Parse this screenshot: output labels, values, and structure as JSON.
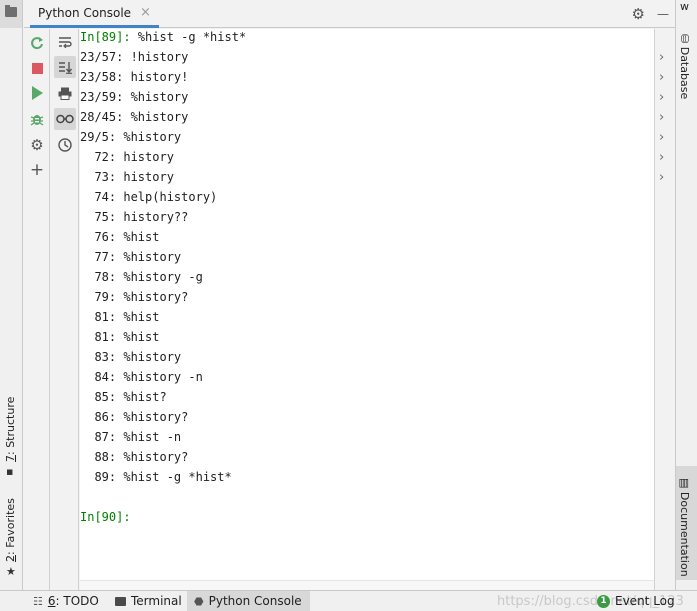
{
  "tab": {
    "title": "Python Console",
    "close": "×"
  },
  "title_tools": {
    "settings_icon": "⚙",
    "minimize_icon": "—"
  },
  "toolbar": {
    "rerun": "rerun-icon",
    "stop": "stop-icon",
    "run": "run-icon",
    "debug": "debug-icon",
    "settings": "gear-icon",
    "add": "+"
  },
  "toolbar2": {
    "soft_wrap": "soft-wrap-icon",
    "scroll_end": "scroll-to-end-icon",
    "print": "print-icon",
    "show_vars": "glasses-icon",
    "history": "history-icon"
  },
  "console": {
    "prompt_in": "In[89]:",
    "command": " %hist -g *hist*",
    "history": [
      "23/57: !history",
      "23/58: history!",
      "23/59: %history",
      "28/45: %history",
      "29/5: %history",
      "  72: history",
      "  73: history",
      "  74: help(history)",
      "  75: history??",
      "  76: %hist",
      "  77: %history",
      "  78: %history -g",
      "  79: %history?",
      "  81: %hist",
      "  81: %hist",
      "  83: %history",
      "  84: %history -n",
      "  85: %hist?",
      "  86: %history?",
      "  87: %hist -n",
      "  88: %history?",
      "  89: %hist -g *hist*"
    ],
    "prompt_next": "In[90]:"
  },
  "left_stripe": {
    "structure_num": "7",
    "structure_label": ": Structure",
    "favorites_num": "2",
    "favorites_label": ": Favorites"
  },
  "right_stripe": {
    "top_label": "w",
    "database": "Database",
    "documentation": "Documentation"
  },
  "statusbar": {
    "todo_num": "6",
    "todo_label": ": TODO",
    "terminal": "Terminal",
    "python_console": "Python Console",
    "event_log": "Event Log",
    "event_count": "1",
    "watermark": "https://blog.csdn.net/qq_123"
  },
  "colors": {
    "prompt": "#008000",
    "tab_underline": "#4083c9",
    "stop": "#db5860",
    "run": "#59a869"
  }
}
